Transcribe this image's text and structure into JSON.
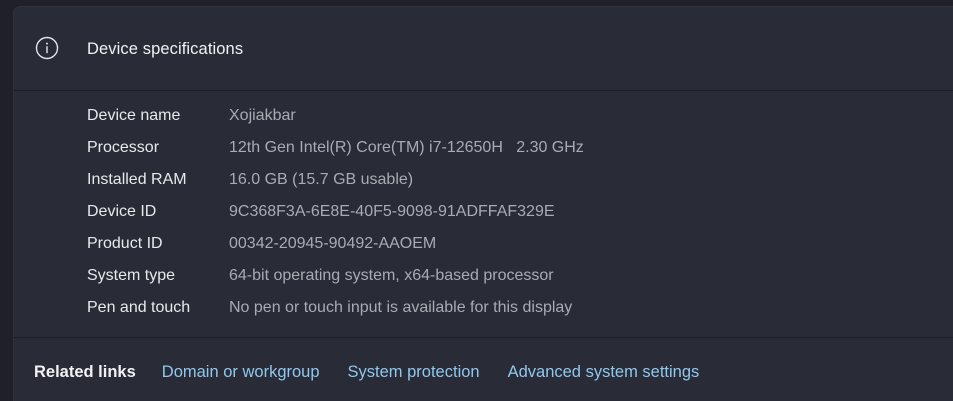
{
  "header": {
    "icon": "info-icon",
    "title": "Device specifications"
  },
  "specs": [
    {
      "label": "Device name",
      "value": "Xojiakbar"
    },
    {
      "label": "Processor",
      "value": "12th Gen Intel(R) Core(TM) i7-12650H   2.30 GHz"
    },
    {
      "label": "Installed RAM",
      "value": "16.0 GB (15.7 GB usable)"
    },
    {
      "label": "Device ID",
      "value": "9C368F3A-6E8E-40F5-9098-91ADFFAF329E"
    },
    {
      "label": "Product ID",
      "value": "00342-20945-90492-AAOEM"
    },
    {
      "label": "System type",
      "value": "64-bit operating system, x64-based processor"
    },
    {
      "label": "Pen and touch",
      "value": "No pen or touch input is available for this display"
    }
  ],
  "related": {
    "title": "Related links",
    "links": [
      "Domain or workgroup",
      "System protection",
      "Advanced system settings"
    ]
  },
  "colors": {
    "background": "#1f2029",
    "card": "#292b36",
    "link": "#8fc8ee",
    "label": "#e8e9ec",
    "value": "#a9abb3"
  }
}
